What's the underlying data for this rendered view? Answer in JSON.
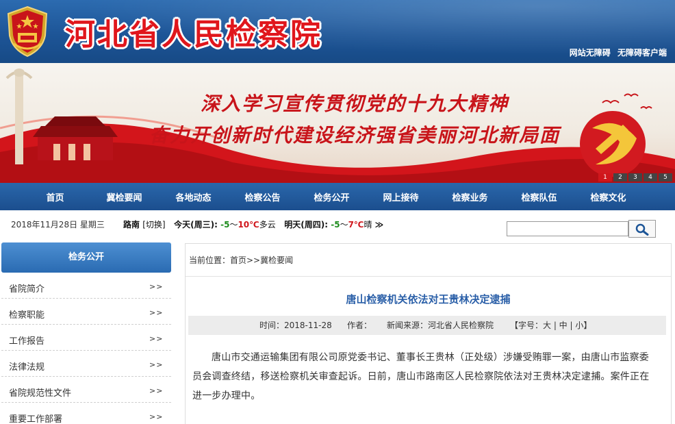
{
  "header": {
    "site_title": "河北省人民检察院",
    "accessibility_link": "网站无障碍",
    "client_link": "无障碍客户端"
  },
  "banner": {
    "slogan_line1": "深入学习宣传贯彻党的十九大精神",
    "slogan_line2": "奋力开创新时代建设经济强省美丽河北新局面",
    "slides": [
      "1",
      "2",
      "3",
      "4",
      "5"
    ],
    "active_slide": "1"
  },
  "nav": {
    "items": [
      "首页",
      "冀检要闻",
      "各地动态",
      "检察公告",
      "检务公开",
      "网上接待",
      "检察业务",
      "检察队伍",
      "检察文化"
    ]
  },
  "infobar": {
    "date": "2018年11月28日 星期三",
    "city": "路南",
    "switch_label": "[切换]",
    "today_label": "今天(周三):",
    "today_low": "-5",
    "today_sep": "～",
    "today_high": "10℃",
    "today_cond": "多云",
    "tomorrow_label": "明天(周四):",
    "tomorrow_low": "-5",
    "tomorrow_sep": "～",
    "tomorrow_high": "7℃",
    "tomorrow_cond": "晴",
    "more": "≫"
  },
  "search": {
    "value": ""
  },
  "sidebar": {
    "heading": "检务公开",
    "arrow": ">>",
    "items": [
      "省院简介",
      "检察职能",
      "工作报告",
      "法律法规",
      "省院规范性文件",
      "重要工作部署"
    ]
  },
  "main": {
    "breadcrumb": "当前位置：首页>>冀检要闻",
    "title": "唐山检察机关依法对王贵林决定逮捕",
    "meta_time": "时间：2018-11-28",
    "meta_author": "作者：",
    "meta_source": "新闻来源：河北省人民检察院",
    "meta_fontsize": "【字号：大 | 中 | 小】",
    "body": "唐山市交通运输集团有限公司原党委书记、董事长王贵林（正处级）涉嫌受贿罪一案，由唐山市监察委员会调查终结，移送检察机关审查起诉。日前，唐山市路南区人民检察院依法对王贵林决定逮捕。案件正在进一步办理中。"
  },
  "colors": {
    "brand_blue": "#1d5597",
    "brand_red": "#e0161c",
    "title_blue": "#2a5fa8",
    "temp_low": "#1a8a1a",
    "temp_high": "#d0161c"
  }
}
